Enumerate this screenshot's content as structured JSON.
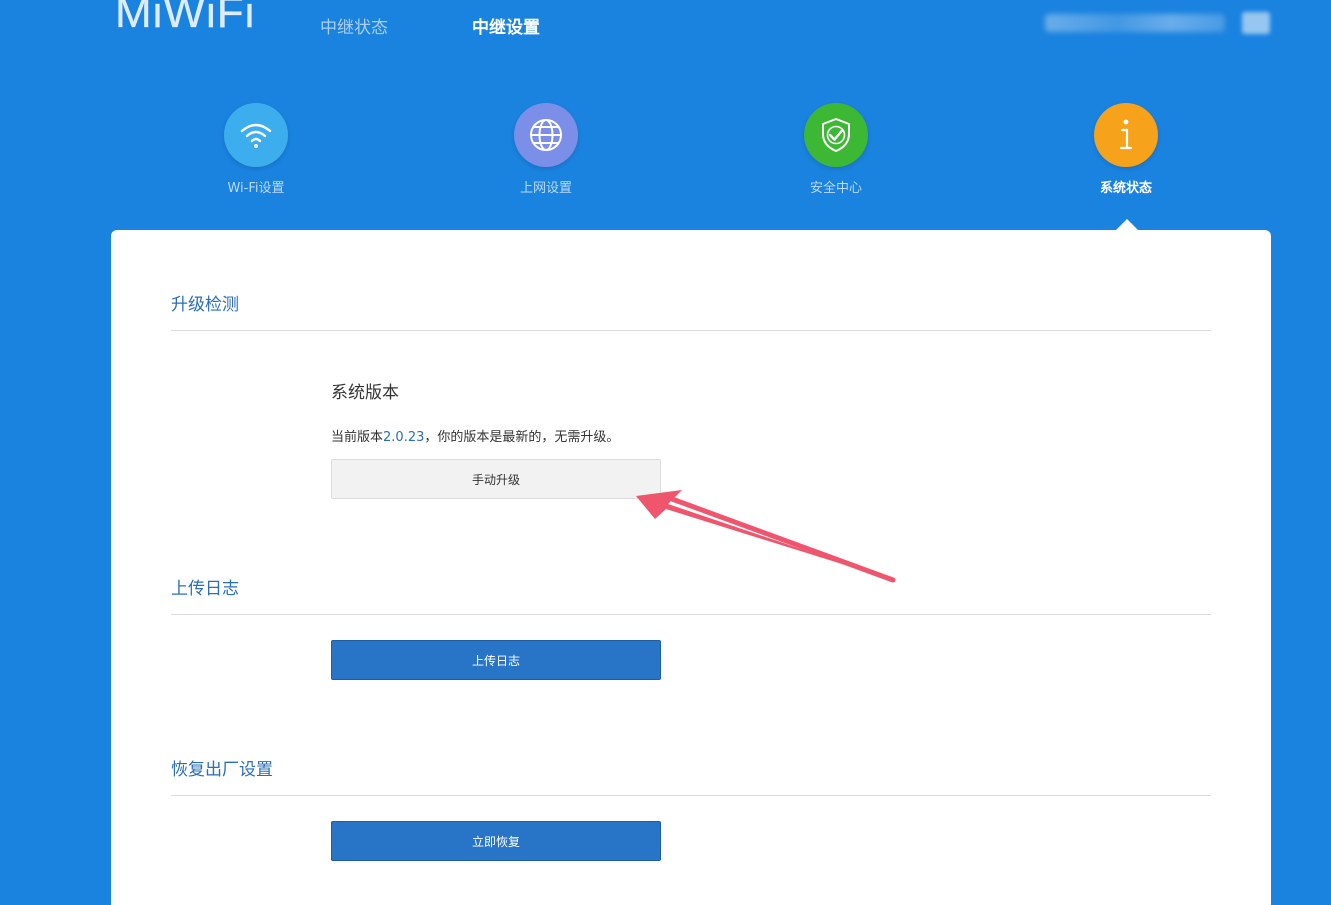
{
  "header": {
    "logo": "MiWiFi",
    "tabs": [
      {
        "label": "中继状态",
        "active": false
      },
      {
        "label": "中继设置",
        "active": true
      }
    ]
  },
  "functions": [
    {
      "label": "Wi-Fi设置",
      "icon": "wifi-icon",
      "color": "#3daeed"
    },
    {
      "label": "上网设置",
      "icon": "globe-icon",
      "color": "#7b8fe8"
    },
    {
      "label": "安全中心",
      "icon": "shield-icon",
      "color": "#3cb834"
    },
    {
      "label": "系统状态",
      "icon": "info-icon",
      "color": "#f7a21b",
      "active": true
    }
  ],
  "upgrade": {
    "title": "升级检测",
    "subtitle": "系统版本",
    "current_prefix": "当前版本",
    "version": "2.0.23",
    "current_suffix": "，你的版本是最新的，无需升级。",
    "button": "手动升级"
  },
  "log": {
    "title": "上传日志",
    "button": "上传日志"
  },
  "reset": {
    "title": "恢复出厂设置",
    "button": "立即恢复"
  },
  "colors": {
    "background": "#1a82df",
    "accent_text": "#2a6fb5",
    "primary_button": "#2874c7",
    "annotation_arrow": "#f0556e"
  }
}
